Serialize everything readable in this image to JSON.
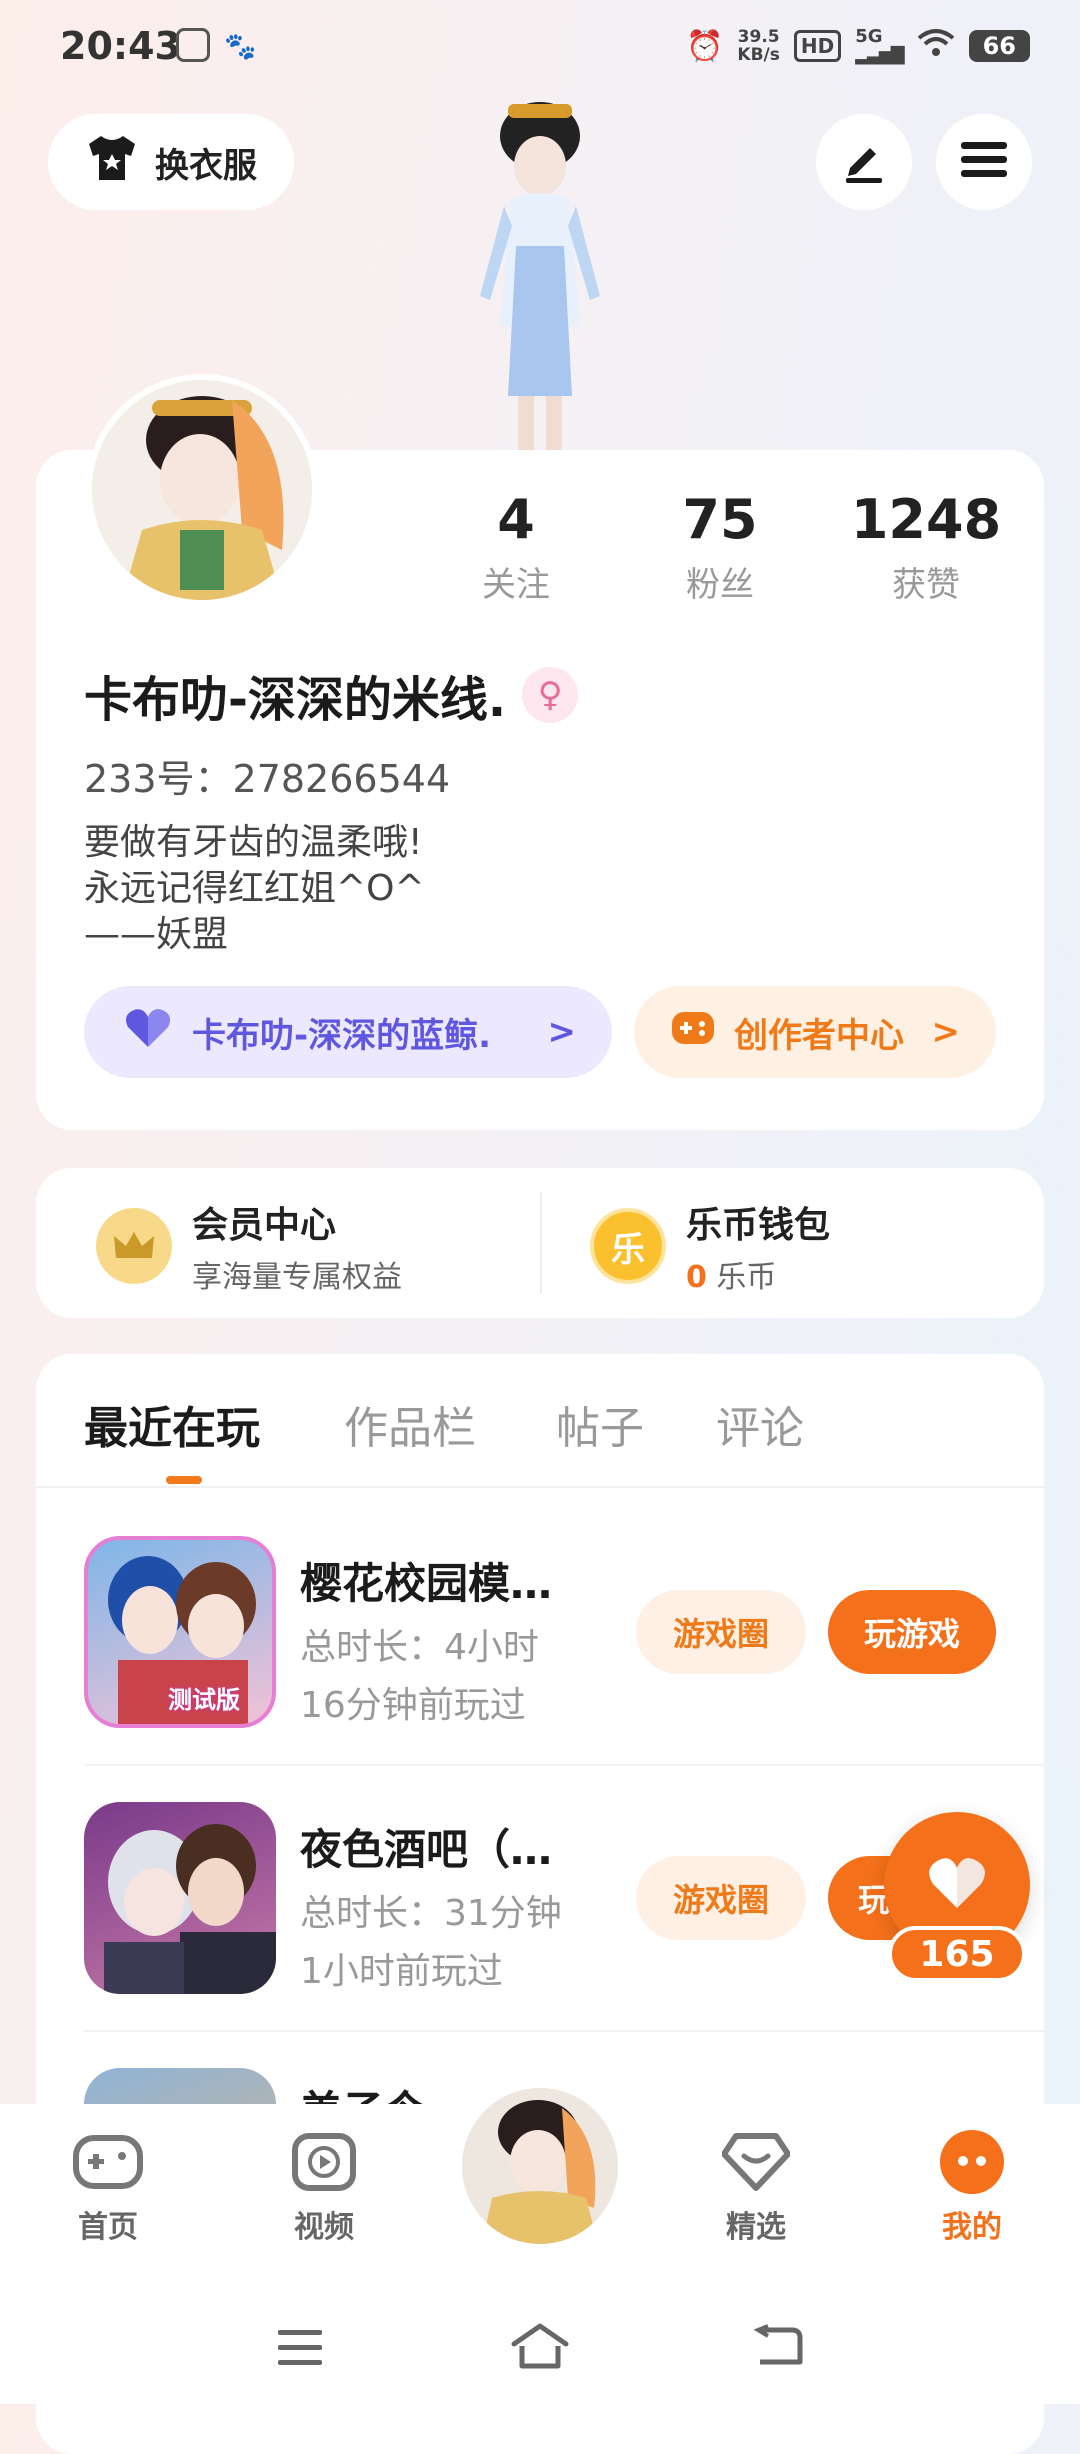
{
  "status_bar": {
    "time": "20:43",
    "net_speed_value": "39.5",
    "net_speed_unit": "KB/s",
    "hd": "HD",
    "signal": "5G",
    "battery": "66"
  },
  "top_bar": {
    "outfit_button": "换衣服"
  },
  "profile": {
    "username": "卡布叻-深深的米线.",
    "gender_symbol": "♀",
    "uid_label": "233号：",
    "uid": "278266544",
    "bio": [
      "要做有牙齿的温柔哦!",
      "永远记得红红姐^O^",
      "——妖盟"
    ],
    "stats": [
      {
        "value": "4",
        "label": "关注"
      },
      {
        "value": "75",
        "label": "粉丝"
      },
      {
        "value": "1248",
        "label": "获赞"
      }
    ],
    "whale_chip": "卡布叻-深深的蓝鲸.",
    "creator_chip": "创作者中心",
    "chevron": ">"
  },
  "member": {
    "title": "会员中心",
    "subtitle": "享海量专属权益"
  },
  "wallet": {
    "title": "乐币钱包",
    "amount": "0",
    "unit": "乐币",
    "icon_text": "乐"
  },
  "tabs": [
    "最近在玩",
    "作品栏",
    "帖子",
    "评论"
  ],
  "games": [
    {
      "title": "樱花校园模…",
      "duration": "总时长：4小时",
      "last_played": "16分钟前玩过",
      "circle_btn": "游戏圈",
      "play_btn": "玩游戏",
      "thumb_text": "测试版"
    },
    {
      "title": "夜色酒吧（…",
      "duration": "总时长：31分钟",
      "last_played": "1小时前玩过",
      "circle_btn": "游戏圈",
      "play_btn": "玩"
    },
    {
      "title": "美子今…"
    }
  ],
  "float_like": {
    "count": "165"
  },
  "bottom_nav": [
    {
      "label": "首页",
      "active": false
    },
    {
      "label": "视频",
      "active": false
    },
    {
      "label": "精选",
      "active": false
    },
    {
      "label": "我的",
      "active": true
    }
  ],
  "colors": {
    "accent": "#f5701a",
    "whale": "#5f57e0",
    "whale_bg": "#ece8fd",
    "creator_bg": "#fff0e4"
  }
}
